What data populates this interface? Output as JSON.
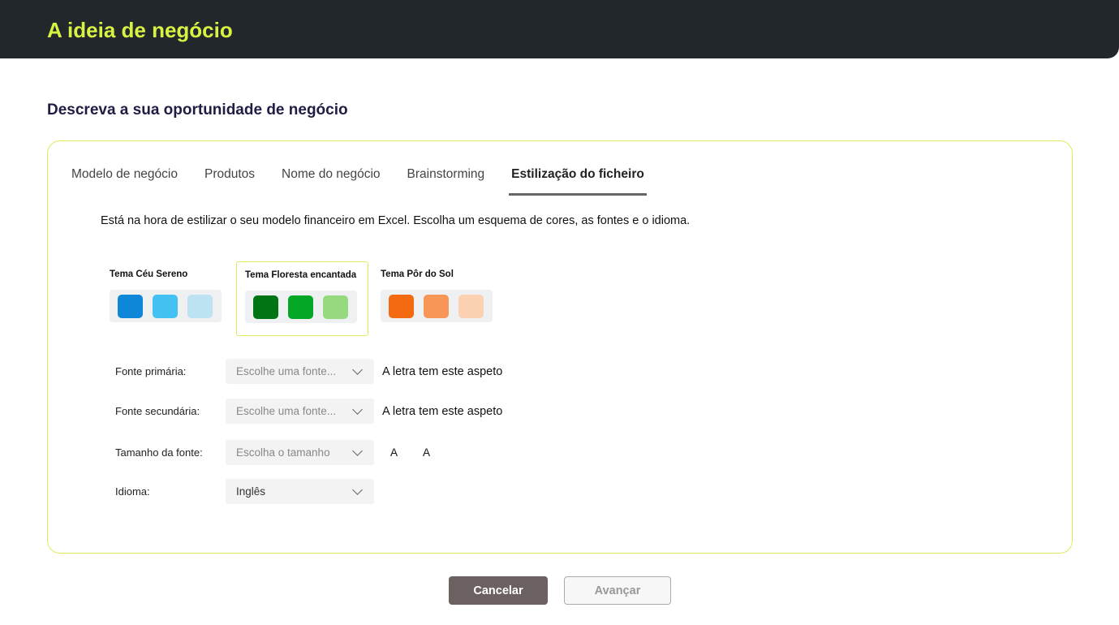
{
  "header": {
    "title": "A ideia de negócio"
  },
  "page": {
    "subtitle": "Descreva a sua oportunidade de negócio"
  },
  "tabs": [
    {
      "label": "Modelo de negócio"
    },
    {
      "label": "Produtos"
    },
    {
      "label": "Nome do negócio"
    },
    {
      "label": "Brainstorming"
    },
    {
      "label": "Estilização do ficheiro",
      "active": true
    }
  ],
  "intro": "Está na hora de estilizar o seu modelo financeiro em Excel. Escolha um esquema de cores, as fontes e o idioma.",
  "themes": [
    {
      "label": "Tema Céu Sereno",
      "colors": [
        "#0f87d8",
        "#42c1f2",
        "#bde2f2"
      ],
      "selected": false
    },
    {
      "label": "Tema Floresta encantada",
      "colors": [
        "#017413",
        "#05a826",
        "#96d97f"
      ],
      "selected": true
    },
    {
      "label": "Tema Pôr do Sol",
      "colors": [
        "#f36a10",
        "#f79657",
        "#fbd1b2"
      ],
      "selected": false
    }
  ],
  "form": {
    "primary_font": {
      "label": "Fonte primária:",
      "placeholder": "Escolhe uma fonte...",
      "preview": "A letra tem este aspeto"
    },
    "secondary_font": {
      "label": "Fonte secundária:",
      "placeholder": "Escolhe uma fonte...",
      "preview": "A letra tem este aspeto"
    },
    "font_size": {
      "label": "Tamanho da fonte:",
      "placeholder": "Escolha o tamanho",
      "preview_small": "A",
      "preview_large": "A"
    },
    "language": {
      "label": "Idioma:",
      "value": "Inglês"
    }
  },
  "buttons": {
    "cancel": "Cancelar",
    "next": "Avançar"
  },
  "colors": {
    "header_bg": "#22272b",
    "title": "#d8f244",
    "card_border": "#e2ea5c",
    "cancel_bg": "#6b6160"
  }
}
